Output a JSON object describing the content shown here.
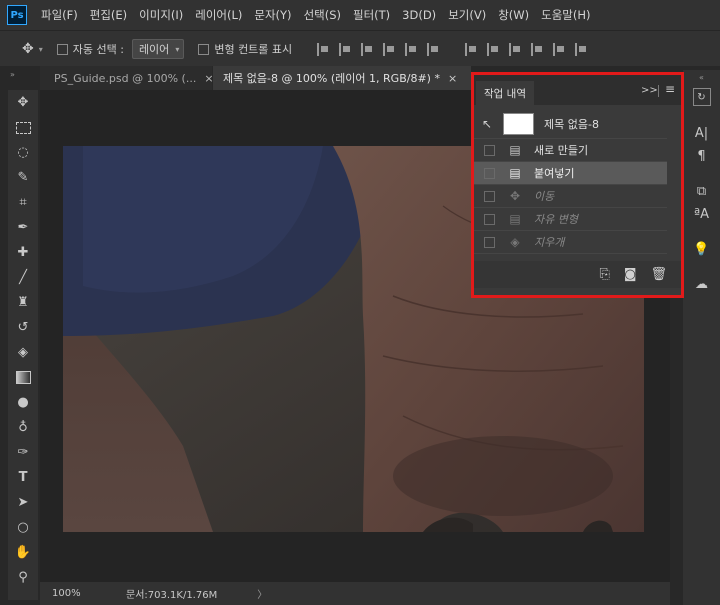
{
  "app": {
    "logo": "Ps"
  },
  "menu": [
    "파일(F)",
    "편집(E)",
    "이미지(I)",
    "레이어(L)",
    "문자(Y)",
    "선택(S)",
    "필터(T)",
    "3D(D)",
    "보기(V)",
    "창(W)",
    "도움말(H)"
  ],
  "options": {
    "auto_select_label": "자동 선택 :",
    "auto_select_value": "레이어",
    "transform_label": "변형 컨트롤 표시"
  },
  "tabs": [
    {
      "label": "PS_Guide.psd @ 100% (...",
      "close": "×"
    },
    {
      "label": "제목 없음-8 @ 100% (레이어 1, RGB/8#) *",
      "close": "×"
    }
  ],
  "history_panel": {
    "title": "작업 내역",
    "snapshot_label": "제목 없음-8",
    "items": [
      {
        "label": "새로 만들기",
        "icon": "document-icon",
        "state": "active"
      },
      {
        "label": "붙여넣기",
        "icon": "document-icon",
        "state": "selected"
      },
      {
        "label": "이동",
        "icon": "move-icon",
        "state": "undone"
      },
      {
        "label": "자유 변형",
        "icon": "document-icon",
        "state": "undone"
      },
      {
        "label": "지우개",
        "icon": "eraser-icon",
        "state": "undone"
      }
    ]
  },
  "status": {
    "zoom": "100%",
    "doc_size": "문서:703.1K/1.76M",
    "arrow": "〉"
  },
  "colors": {
    "highlight_border": "#e21a1a",
    "selected_row": "#5a5a5a",
    "ps_blue": "#31a8ff"
  }
}
